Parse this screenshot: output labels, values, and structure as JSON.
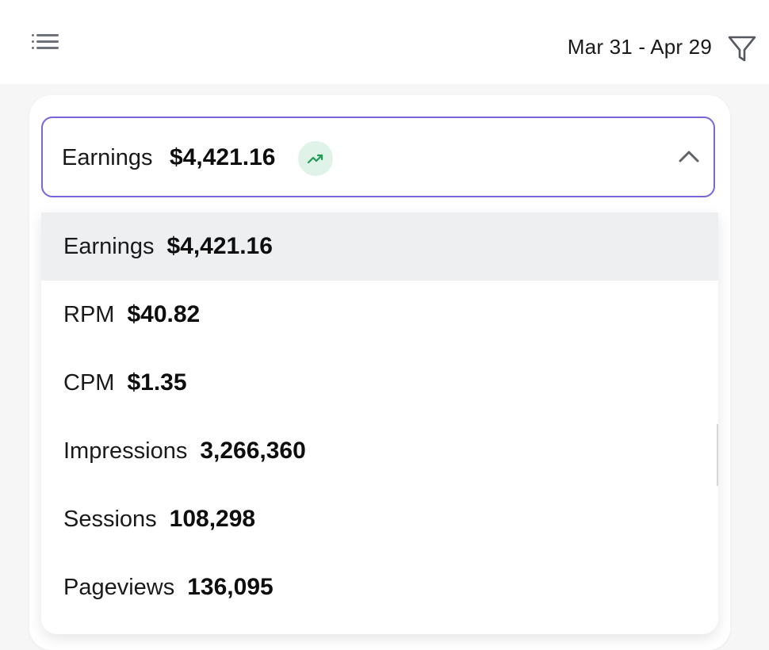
{
  "header": {
    "menu_icon": "hamburger-menu-icon",
    "date_range": "Mar 31 - Apr 29",
    "filter_icon": "filter-funnel-icon"
  },
  "metric_select": {
    "label": "Earnings",
    "value": "$4,421.16",
    "trend_icon": "trending-up-icon",
    "trend_color": "#1f9d55",
    "chevron_icon": "chevron-up-icon",
    "border_color": "#7a64d8"
  },
  "options": [
    {
      "label": "Earnings",
      "value": "$4,421.16",
      "selected": true
    },
    {
      "label": "RPM",
      "value": "$40.82",
      "selected": false
    },
    {
      "label": "CPM",
      "value": "$1.35",
      "selected": false
    },
    {
      "label": "Impressions",
      "value": "3,266,360",
      "selected": false
    },
    {
      "label": "Sessions",
      "value": "108,298",
      "selected": false
    },
    {
      "label": "Pageviews",
      "value": "136,095",
      "selected": false
    }
  ]
}
